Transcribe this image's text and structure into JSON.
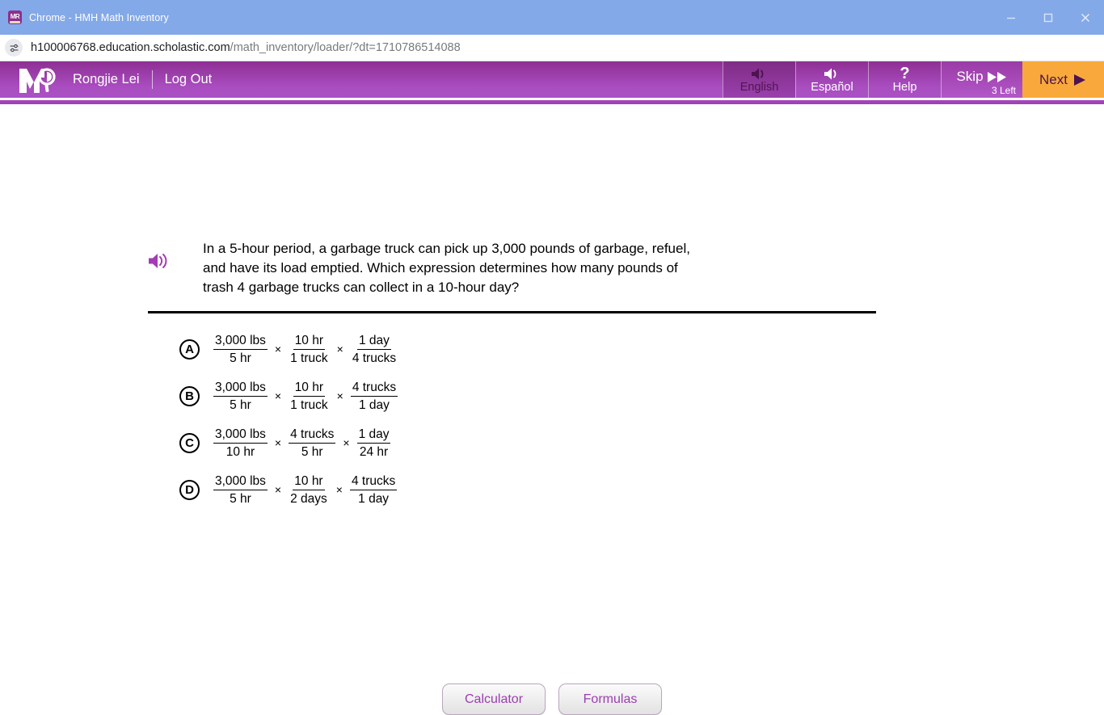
{
  "browser": {
    "window_title": "Chrome - HMH Math Inventory",
    "favicon_text": "MR",
    "url_host": "h100006768.education.scholastic.com",
    "url_path": "/math_inventory/loader/?dt=1710786514088",
    "controls": {
      "minimize": "minimize-icon",
      "maximize": "maximize-icon",
      "close": "close-icon"
    },
    "site_settings_icon": "tune-sliders-icon"
  },
  "header": {
    "logo_alt": "math-inventory-logo",
    "user_name": "Rongjie Lei",
    "logout_label": "Log Out",
    "buttons": [
      {
        "label": "English",
        "icon": "speaker-icon",
        "active": true
      },
      {
        "label": "Español",
        "icon": "speaker-icon",
        "active": false
      },
      {
        "label": "Help",
        "icon": "question-mark-icon",
        "active": false
      }
    ],
    "skip": {
      "label": "Skip",
      "icon": "fast-forward-icon",
      "remaining": "3 Left"
    },
    "next": {
      "label": "Next",
      "icon": "play-triangle-icon"
    },
    "colors": {
      "purple_dark": "#8e2f93",
      "purple_light": "#ab51c4",
      "orange": "#f9a93b",
      "active_text": "#4c1350"
    }
  },
  "question": {
    "audio_icon": "speaker-icon",
    "text": "In a 5-hour period, a garbage truck can pick up 3,000 pounds of garbage, refuel, and have its load emptied. Which expression determines how many pounds of trash 4 garbage trucks can collect in a 10-hour day?",
    "options": [
      {
        "letter": "A",
        "fractions": [
          {
            "num": "3,000 lbs",
            "den": "5 hr"
          },
          {
            "num": "10 hr",
            "den": "1 truck"
          },
          {
            "num": "1 day",
            "den": "4 trucks"
          }
        ],
        "operator": "×"
      },
      {
        "letter": "B",
        "fractions": [
          {
            "num": "3,000 lbs",
            "den": "5 hr"
          },
          {
            "num": "10 hr",
            "den": "1 truck"
          },
          {
            "num": "4 trucks",
            "den": "1 day"
          }
        ],
        "operator": "×"
      },
      {
        "letter": "C",
        "fractions": [
          {
            "num": "3,000 lbs",
            "den": "10 hr"
          },
          {
            "num": "4 trucks",
            "den": "5 hr"
          },
          {
            "num": "1 day",
            "den": "24 hr"
          }
        ],
        "operator": "×"
      },
      {
        "letter": "D",
        "fractions": [
          {
            "num": "3,000 lbs",
            "den": "5 hr"
          },
          {
            "num": "10 hr",
            "den": "2 days"
          },
          {
            "num": "4 trucks",
            "den": "1 day"
          }
        ],
        "operator": "×"
      }
    ]
  },
  "tools": {
    "calculator_label": "Calculator",
    "formulas_label": "Formulas"
  }
}
